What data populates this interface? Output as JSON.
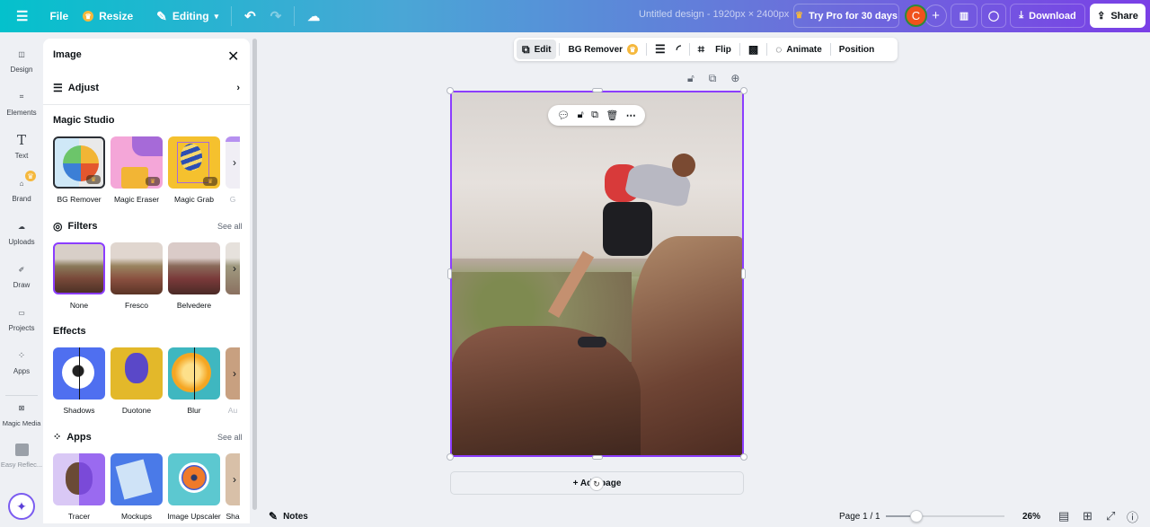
{
  "topbar": {
    "menu_icon": "hamburger-icon",
    "file": "File",
    "resize": "Resize",
    "editing": "Editing",
    "design_title": "Untitled design - 1920px × 2400px",
    "try_pro": "Try Pro for 30 days",
    "avatar_initial": "C",
    "download": "Download",
    "share": "Share"
  },
  "rail": {
    "items": [
      {
        "label": "Design",
        "icon": "layout-icon"
      },
      {
        "label": "Elements",
        "icon": "shapes-icon"
      },
      {
        "label": "Text",
        "icon": "text-icon"
      },
      {
        "label": "Brand",
        "icon": "brand-icon"
      },
      {
        "label": "Uploads",
        "icon": "cloud-upload-icon"
      },
      {
        "label": "Draw",
        "icon": "pen-icon"
      },
      {
        "label": "Projects",
        "icon": "folder-icon"
      },
      {
        "label": "Apps",
        "icon": "apps-icon"
      },
      {
        "label": "Magic Media",
        "icon": "magic-media-icon"
      },
      {
        "label": "Easy Reflec...",
        "icon": "easy-reflection-icon"
      }
    ]
  },
  "panel": {
    "title": "Image",
    "adjust": "Adjust",
    "magic_studio": {
      "title": "Magic Studio",
      "items": [
        "BG Remover",
        "Magic Eraser",
        "Magic Grab",
        "G"
      ]
    },
    "filters": {
      "title": "Filters",
      "see_all": "See all",
      "items": [
        "None",
        "Fresco",
        "Belvedere",
        ""
      ],
      "selected": "None"
    },
    "effects": {
      "title": "Effects",
      "items": [
        "Shadows",
        "Duotone",
        "Blur",
        "Au"
      ]
    },
    "apps": {
      "title": "Apps",
      "see_all": "See all",
      "items": [
        "Tracer",
        "Mockups",
        "Image Upscaler",
        "Sha"
      ]
    }
  },
  "context_toolbar": {
    "edit": "Edit",
    "bg_remover": "BG Remover",
    "flip": "Flip",
    "animate": "Animate",
    "position": "Position"
  },
  "canvas": {
    "add_page": "+ Add page"
  },
  "footer": {
    "notes": "Notes",
    "page": "Page 1 / 1",
    "zoom": "26%",
    "zoom_slider_fraction": 0.26
  },
  "colors": {
    "accent": "#8b3dff",
    "crown": "#f5b83d",
    "avatar": "#f0521c"
  }
}
